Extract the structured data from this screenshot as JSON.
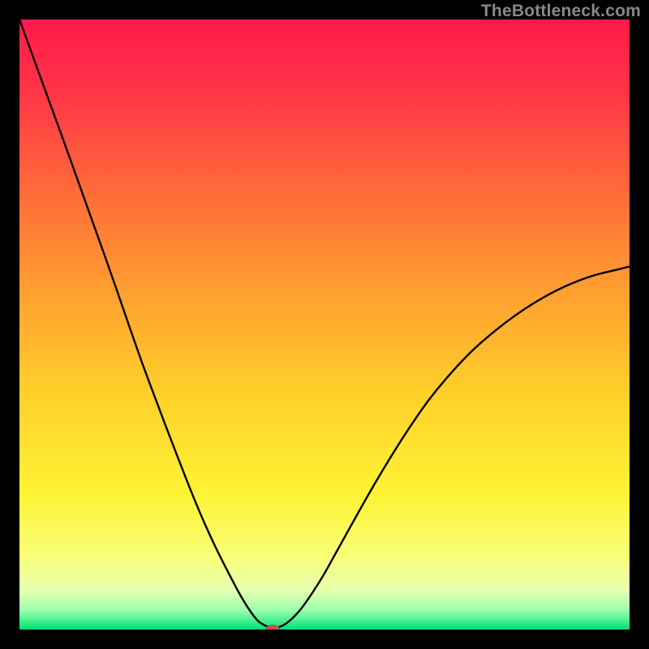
{
  "watermark": "TheBottleneck.com",
  "chart_data": {
    "type": "line",
    "title": "",
    "xlabel": "",
    "ylabel": "",
    "xlim": [
      0,
      100
    ],
    "ylim": [
      0,
      100
    ],
    "background_gradient": {
      "stops": [
        {
          "offset": 0.0,
          "color": "#ff1a4b"
        },
        {
          "offset": 0.12,
          "color": "#ff3547"
        },
        {
          "offset": 0.28,
          "color": "#ff6a3a"
        },
        {
          "offset": 0.45,
          "color": "#ffa030"
        },
        {
          "offset": 0.62,
          "color": "#ffd22a"
        },
        {
          "offset": 0.78,
          "color": "#fff335"
        },
        {
          "offset": 0.88,
          "color": "#f8ff77"
        },
        {
          "offset": 0.935,
          "color": "#e8ffb0"
        },
        {
          "offset": 0.968,
          "color": "#9cffad"
        },
        {
          "offset": 1.0,
          "color": "#00e17a"
        }
      ]
    },
    "series": [
      {
        "name": "bottleneck-curve",
        "color": "#000000",
        "x": [
          0.0,
          2.0,
          4.0,
          6.0,
          8.0,
          10.0,
          12.0,
          14.0,
          16.0,
          18.0,
          20.0,
          22.0,
          24.0,
          26.0,
          28.0,
          30.0,
          32.0,
          34.0,
          36.0,
          37.5,
          39.0,
          40.0,
          41.0,
          42.5,
          44.0,
          46.0,
          48.0,
          50.0,
          52.0,
          55.0,
          58.0,
          61.0,
          64.0,
          67.0,
          70.0,
          74.0,
          78.0,
          82.0,
          86.0,
          90.0,
          94.0,
          98.0,
          100.0
        ],
        "y": [
          100.0,
          94.5,
          89.0,
          83.5,
          78.0,
          72.4,
          66.8,
          61.2,
          55.5,
          49.7,
          44.0,
          38.6,
          33.3,
          28.1,
          23.0,
          18.2,
          13.8,
          9.8,
          6.0,
          3.5,
          1.5,
          0.8,
          0.4,
          0.4,
          1.2,
          3.2,
          6.0,
          9.2,
          12.8,
          18.2,
          23.5,
          28.5,
          33.2,
          37.5,
          41.2,
          45.5,
          49.0,
          52.0,
          54.5,
          56.5,
          58.0,
          59.0,
          59.5
        ]
      }
    ],
    "marker": {
      "name": "optimal-point",
      "x": 41.5,
      "y": 0.0,
      "rx": 9,
      "ry": 6,
      "color": "#c1524e"
    }
  }
}
